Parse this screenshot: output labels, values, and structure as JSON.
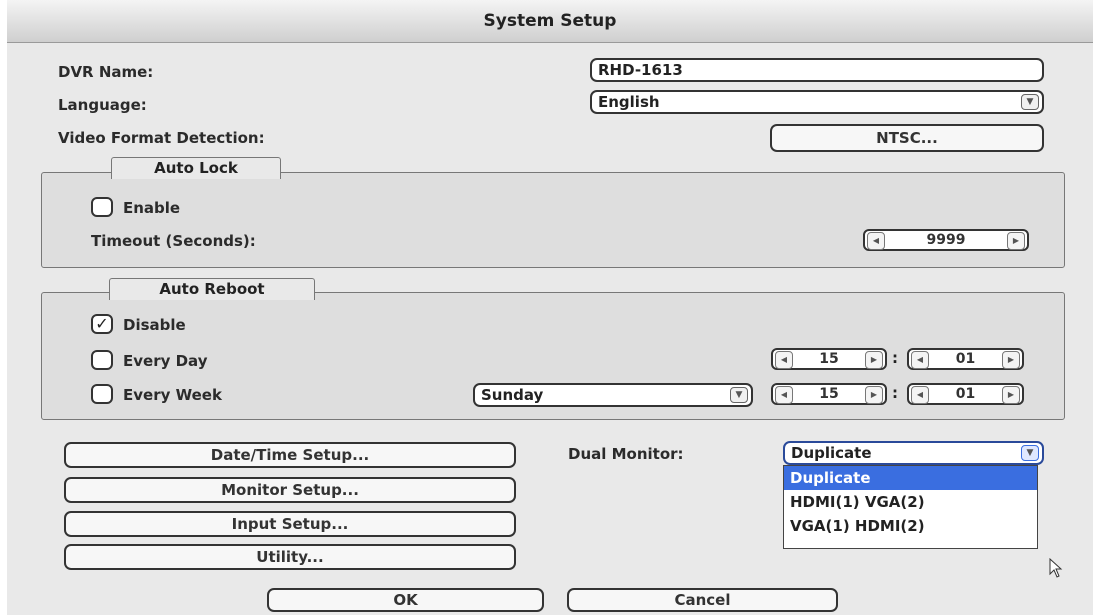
{
  "window": {
    "title": "System Setup"
  },
  "fields": {
    "dvr_name_label": "DVR Name:",
    "dvr_name_value": "RHD-1613",
    "language_label": "Language:",
    "language_value": "English",
    "video_format_label": "Video Format Detection:",
    "video_format_button": "NTSC..."
  },
  "auto_lock": {
    "legend": "Auto Lock",
    "enable_label": "Enable",
    "enable_checked": false,
    "timeout_label": "Timeout (Seconds):",
    "timeout_value": "9999"
  },
  "auto_reboot": {
    "legend": "Auto Reboot",
    "disable_label": "Disable",
    "disable_checked": true,
    "every_day_label": "Every Day",
    "every_day_checked": false,
    "every_day_hour": "15",
    "every_day_minute": "01",
    "every_week_label": "Every Week",
    "every_week_checked": false,
    "every_week_day": "Sunday",
    "every_week_hour": "15",
    "every_week_minute": "01",
    "colon": ":"
  },
  "buttons": {
    "date_time": "Date/Time Setup...",
    "monitor": "Monitor Setup...",
    "input": "Input Setup...",
    "utility": "Utility...",
    "ok": "OK",
    "cancel": "Cancel"
  },
  "dual_monitor": {
    "label": "Dual Monitor:",
    "value": "Duplicate",
    "options": [
      "Duplicate",
      "HDMI(1)  VGA(2)",
      "VGA(1)  HDMI(2)"
    ],
    "selected_index": 0
  },
  "icons": {
    "dropdown_arrow": "chevron-down-icon",
    "spin_left": "triangle-left-icon",
    "spin_right": "triangle-right-icon",
    "checkmark": "checkmark-icon",
    "cursor": "mouse-pointer-icon"
  },
  "colors": {
    "highlight": "#3a6ee0",
    "panel": "#e9e9e9"
  }
}
